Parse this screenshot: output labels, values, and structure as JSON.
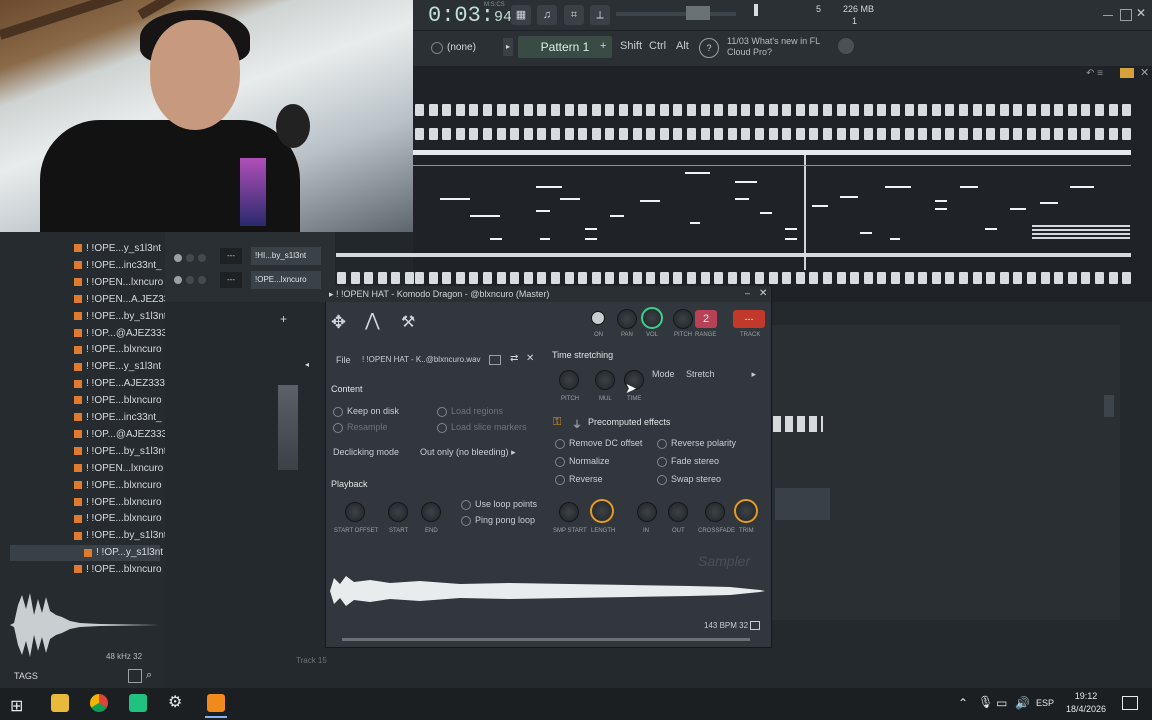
{
  "transport": {
    "time_main": "0:03:",
    "time_frac": "94",
    "time_format": "M:S:CS",
    "cpu": "5",
    "memory": "226 MB",
    "voices": "1"
  },
  "toolbar": {
    "preset": "(none)",
    "pattern": "Pattern 1",
    "plus": "+",
    "shift": "Shift",
    "ctrl": "Ctrl",
    "alt": "Alt",
    "news_index": "11/03",
    "news_text": "What's new in FL Cloud Pro?"
  },
  "browser": {
    "items": [
      "! !OPE...y_s1l3nt",
      "! !OPE...inc33nt_",
      "! !OPEN...lxncuro",
      "! !OPEN...A.JEZ333",
      "! !OPE...by_s1l3nt",
      "! !OP...@AJEZ333",
      "! !OPE...blxncuro",
      "! !OPE...y_s1l3nt",
      "! !OPE...AJEZ333",
      "! !OPE...blxncuro",
      "! !OPE...inc33nt_",
      "! !OP...@AJEZ333",
      "! !OPE...by_s1l3nt",
      "! !OPEN...lxncuro",
      "! !OPE...blxncuro",
      "! !OPE...blxncuro",
      "! !OPE...blxncuro",
      "! !OPE...by_s1l3nt",
      "! !OP...y_s1l3nt",
      "! !OPE...blxncuro"
    ],
    "selected_index": 18,
    "sample_rate": "48 kHz 32",
    "tags_label": "TAGS"
  },
  "rack": {
    "channels": [
      "!HI...by_s1l3nt",
      "!OPE...lxncuro"
    ]
  },
  "sampler": {
    "title": "! !OPEN HAT - Komodo Dragon - @blxncuro (Master)",
    "file_label": "File",
    "file_name": "! !OPEN HAT - K..@blxncuro.wav",
    "on": "ON",
    "pan": "PAN",
    "vol": "VOL",
    "pitch": "PITCH",
    "range": "RANGE",
    "range_value": "2",
    "track": "TRACK",
    "track_value": "---",
    "content_head": "Content",
    "keep_on_disk": "Keep on disk",
    "load_regions": "Load regions",
    "resample": "Resample",
    "load_slice_markers": "Load slice markers",
    "declicking_label": "Declicking mode",
    "declicking_value": "Out only (no bleeding)",
    "playback_head": "Playback",
    "use_loop_points": "Use loop points",
    "ping_pong_loop": "Ping pong loop",
    "start_offset": "START OFFSET",
    "start": "START",
    "end": "END",
    "time_stretching_head": "Time stretching",
    "ts_pitch": "PITCH",
    "ts_mul": "MUL",
    "ts_time": "TIME",
    "mode_label": "Mode",
    "mode_value": "Stretch",
    "precomputed_head": "Precomputed effects",
    "remove_dc": "Remove DC offset",
    "normalize": "Normalize",
    "reverse": "Reverse",
    "reverse_polarity": "Reverse polarity",
    "fade_stereo": "Fade stereo",
    "swap_stereo": "Swap stereo",
    "smp_start": "SMP START",
    "length": "LENGTH",
    "in": "IN",
    "out": "OUT",
    "crossfade": "CROSSFADE",
    "trim": "TRIM",
    "watermark": "Sampler",
    "bpm_info": "143 BPM 32"
  },
  "mixer": {
    "track_label": "Track 15"
  },
  "taskbar": {
    "lang": "ESP",
    "time": "19:12",
    "date": "18/4/2026"
  },
  "colors": {
    "accent_orange": "#e79b22",
    "accent_green": "#3cd08f",
    "track_red": "#c0392b",
    "file_icon": "#e07a2f"
  }
}
